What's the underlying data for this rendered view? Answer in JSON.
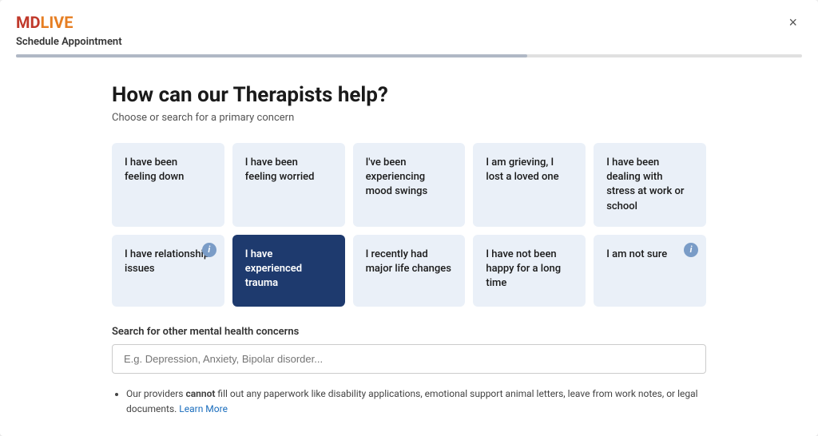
{
  "header": {
    "logo_md": "MD",
    "logo_live": "LIVE",
    "schedule_label": "Schedule Appointment",
    "close_label": "×"
  },
  "progress": {
    "fill_percent": 65
  },
  "main": {
    "title": "How can our Therapists help?",
    "subtitle": "Choose or search for a primary concern",
    "cards_row1": [
      {
        "id": "feeling-down",
        "label": "I have been feeling down",
        "selected": false,
        "info": false
      },
      {
        "id": "feeling-worried",
        "label": "I have been feeling worried",
        "selected": false,
        "info": false
      },
      {
        "id": "mood-swings",
        "label": "I've been experiencing mood swings",
        "selected": false,
        "info": false
      },
      {
        "id": "grieving",
        "label": "I am grieving, I lost a loved one",
        "selected": false,
        "info": false
      },
      {
        "id": "stress-work",
        "label": "I have been dealing with stress at work or school",
        "selected": false,
        "info": false
      }
    ],
    "cards_row2": [
      {
        "id": "relationship-issues",
        "label": "I have relationship issues",
        "selected": false,
        "info": true
      },
      {
        "id": "experienced-trauma",
        "label": "I have experienced trauma",
        "selected": true,
        "info": false
      },
      {
        "id": "major-life-changes",
        "label": "I recently had major life changes",
        "selected": false,
        "info": false
      },
      {
        "id": "not-happy",
        "label": "I have not been happy for a long time",
        "selected": false,
        "info": false
      },
      {
        "id": "not-sure",
        "label": "I am not sure",
        "selected": false,
        "info": true
      }
    ],
    "search": {
      "label": "Search for other mental health concerns",
      "placeholder": "E.g. Depression, Anxiety, Bipolar disorder..."
    },
    "disclaimer": {
      "text_before": "Our providers ",
      "bold_text": "cannot",
      "text_after": " fill out any paperwork like disability applications, emotional support animal letters, leave from work notes, or legal documents. ",
      "link_text": "Learn More",
      "link_href": "#"
    }
  }
}
